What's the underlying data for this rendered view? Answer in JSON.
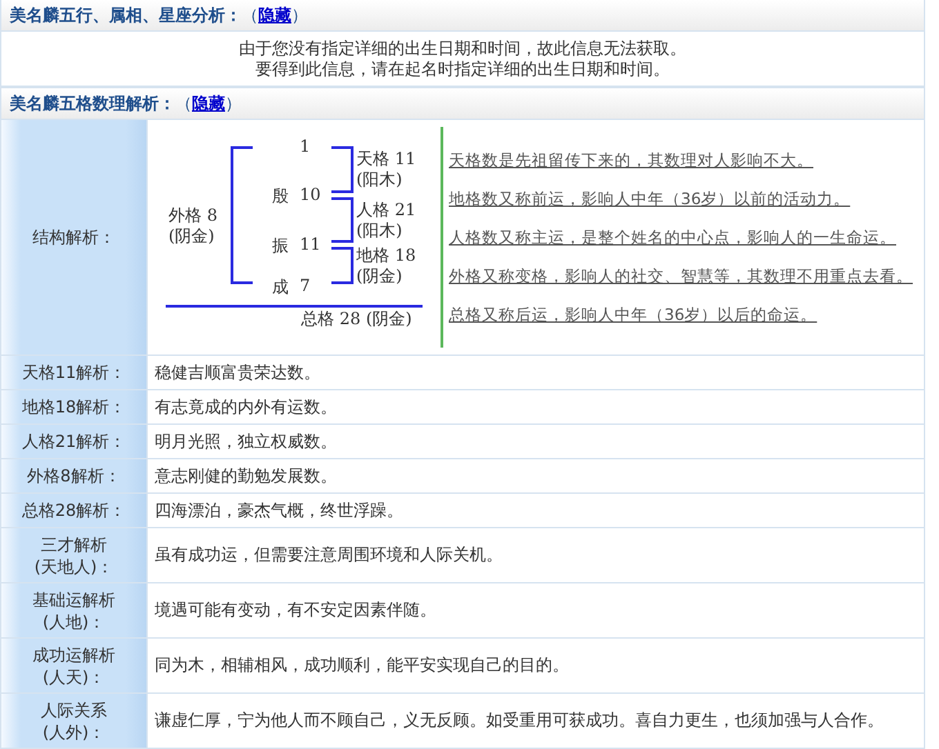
{
  "zodiac_section": {
    "title": "美名麟五行、属相、星座分析：",
    "open": "（",
    "link": "隐藏",
    "close": "）",
    "message_lines": [
      "由于您没有指定详细的出生日期和时间，故此信息无法获取。",
      "要得到此信息，请在起名时指定详细的出生日期和时间。"
    ]
  },
  "grid_section": {
    "title": "美名麟五格数理解析：",
    "open": "（",
    "link": "隐藏",
    "close": "）"
  },
  "structure": {
    "label": "结构解析：",
    "chars": [
      {
        "number": "1"
      },
      {
        "char": "殷",
        "number": "10"
      },
      {
        "char": "振",
        "number": "11"
      },
      {
        "char": "成",
        "number": "7"
      }
    ],
    "grids": [
      {
        "name": "天格",
        "number": "11",
        "element": "(阳木)"
      },
      {
        "name": "人格",
        "number": "21",
        "element": "(阳木)"
      },
      {
        "name": "地格",
        "number": "18",
        "element": "(阴金)"
      }
    ],
    "outer": {
      "name": "外格",
      "number": "8",
      "element": "(阴金)"
    },
    "total": {
      "name": "总格",
      "number": "28",
      "element": "(阴金)"
    },
    "notes": [
      "天格数是先祖留传下来的，其数理对人影响不大。",
      "地格数又称前运，影响人中年（36岁）以前的活动力。",
      "人格数又称主运，是整个姓名的中心点，影响人的一生命运。",
      "外格又称变格，影响人的社交、智慧等，其数理不用重点去看。",
      "总格又称后运，影响人中年（36岁）以后的命运。"
    ]
  },
  "analysis_rows": [
    {
      "label": "天格11解析：",
      "text": "稳健吉顺富贵荣达数。"
    },
    {
      "label": "地格18解析：",
      "text": "有志竟成的内外有运数。"
    },
    {
      "label": "人格21解析：",
      "text": "明月光照，独立权威数。"
    },
    {
      "label": "外格8解析：",
      "text": "意志刚健的勤勉发展数。"
    },
    {
      "label": "总格28解析：",
      "text": "四海漂泊，豪杰气概，终世浮躁。"
    },
    {
      "label": "三才解析\n(天地人)：",
      "text": "虽有成功运，但需要注意周围环境和人际关机。"
    },
    {
      "label": "基础运解析\n(人地)：",
      "text": "境遇可能有变动，有不安定因素伴随。"
    },
    {
      "label": "成功运解析\n(人天)：",
      "text": "同为木，相辅相风，成功顺利，能平安实现自己的目的。"
    },
    {
      "label": "人际关系\n(人外)：",
      "text": "谦虚仁厚，宁为他人而不顾自己，义无反顾。如受重用可获成功。喜自力更生，也须加强与人合作。"
    }
  ]
}
